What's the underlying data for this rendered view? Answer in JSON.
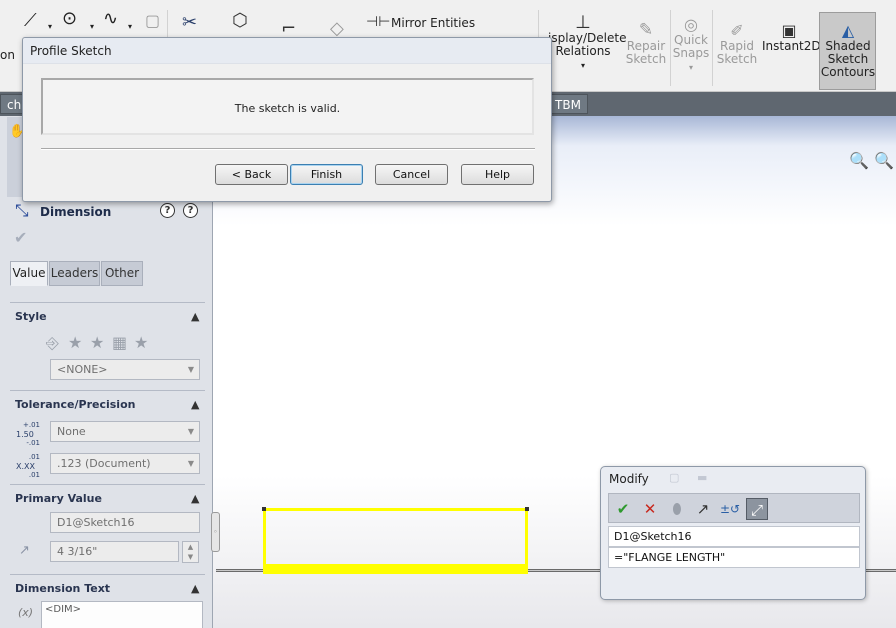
{
  "ribbon": {
    "mirror_entities": "Mirror Entities",
    "display_delete_relations": [
      "isplay/Delete",
      "Relations"
    ],
    "repair_sketch": [
      "Repair",
      "Sketch"
    ],
    "quick_snaps": [
      "Quick",
      "Snaps"
    ],
    "rapid_sketch": [
      "Rapid",
      "Sketch"
    ],
    "instant2d": "Instant2D",
    "shaded_sketch_contours": [
      "Shaded",
      "Sketch",
      "Contours"
    ],
    "left_cut_label": "on"
  },
  "tabs": {
    "left_cut": "ch",
    "right_cut": "TBM"
  },
  "property_manager": {
    "title": "Dimension",
    "tabs": [
      "Value",
      "Leaders",
      "Other"
    ],
    "style": {
      "heading": "Style",
      "combo_value": "<NONE>"
    },
    "tolerance": {
      "heading": "Tolerance/Precision",
      "tolerance_icon_text": [
        "+.01",
        "1.50",
        "-.01"
      ],
      "tolerance_value": "None",
      "precision_icon_text": [
        ".01",
        "X.XX",
        ".01"
      ],
      "precision_value": ".123 (Document)"
    },
    "primary_value": {
      "heading": "Primary Value",
      "name": "D1@Sketch16",
      "value": "4 3/16\""
    },
    "dimension_text": {
      "heading": "Dimension Text",
      "text": "<DIM>",
      "fx_label": "(x)"
    }
  },
  "profile_dialog": {
    "title": "Profile Sketch",
    "message": "The sketch is valid.",
    "buttons": {
      "back": "< Back",
      "finish": "Finish",
      "cancel": "Cancel",
      "help": "Help"
    }
  },
  "modify_dialog": {
    "title": "Modify",
    "name": "D1@Sketch16",
    "expression": "=\"FLANGE LENGTH\""
  },
  "colors": {
    "sketch_highlight": "#ffff00",
    "ok_green": "#2f9a2f",
    "cancel_red": "#c8281e",
    "tab_strip": "#5f6770"
  }
}
